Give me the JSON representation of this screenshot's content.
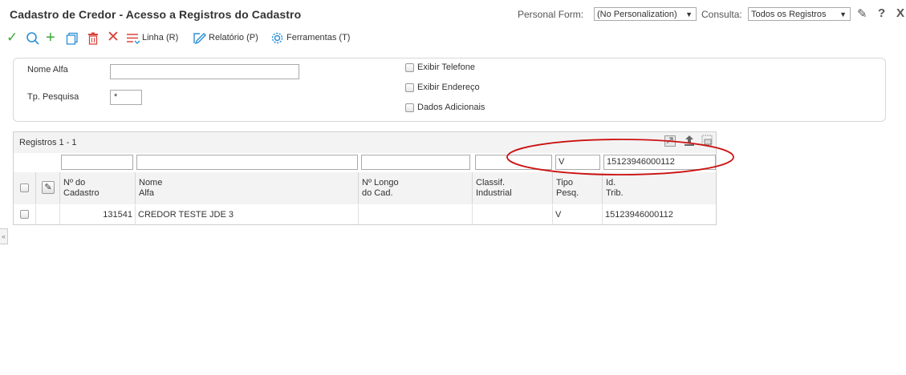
{
  "header": {
    "title": "Cadastro de Credor - Acesso a Registros do Cadastro",
    "personal_form_label": "Personal Form:",
    "personal_form_value": "(No Personalization)",
    "consulta_label": "Consulta:",
    "consulta_value": "Todos os Registros",
    "close_glyph": "X"
  },
  "toolbar": {
    "linha_label": "Linha (R)",
    "relatorio_label": "Relatório (P)",
    "ferramentas_label": "Ferramentas (T)"
  },
  "criteria": {
    "nome_alfa_label": "Nome Alfa",
    "nome_alfa_value": "",
    "tp_pesquisa_label": "Tp. Pesquisa",
    "tp_pesquisa_value": "*",
    "exibir_telefone_label": "Exibir Telefone",
    "exibir_endereco_label": "Exibir Endereço",
    "dados_adicionais_label": "Dados Adicionais"
  },
  "grid": {
    "records_label": "Registros 1 - 1",
    "filters": [
      "",
      "",
      "",
      "",
      "V",
      "15123946000112"
    ],
    "columns": [
      {
        "line1": "Nº do",
        "line2": "Cadastro"
      },
      {
        "line1": "Nome",
        "line2": "Alfa"
      },
      {
        "line1": "Nº Longo",
        "line2": "do Cad."
      },
      {
        "line1": "Classif.",
        "line2": "Industrial"
      },
      {
        "line1": "Tipo",
        "line2": "Pesq."
      },
      {
        "line1": "Id.",
        "line2": "Trib."
      }
    ],
    "rows": [
      {
        "cadastro": "131541",
        "nome": "CREDOR TESTE JDE 3",
        "longo": "",
        "classif": "",
        "tipo": "V",
        "id_trib": "15123946000112"
      }
    ]
  },
  "colors": {
    "accent_green": "#3aa83a",
    "accent_blue": "#2a8fd6",
    "accent_red": "#d9433a",
    "annotation_red": "#cc1111"
  },
  "icons": [
    "check-icon",
    "search-icon",
    "add-icon",
    "copy-icon",
    "delete-icon",
    "cancel-icon",
    "row-menu-icon",
    "report-icon",
    "tools-icon",
    "edit-icon",
    "help-icon",
    "export-icon",
    "upload-icon",
    "maximize-icon",
    "collapse-icon"
  ]
}
